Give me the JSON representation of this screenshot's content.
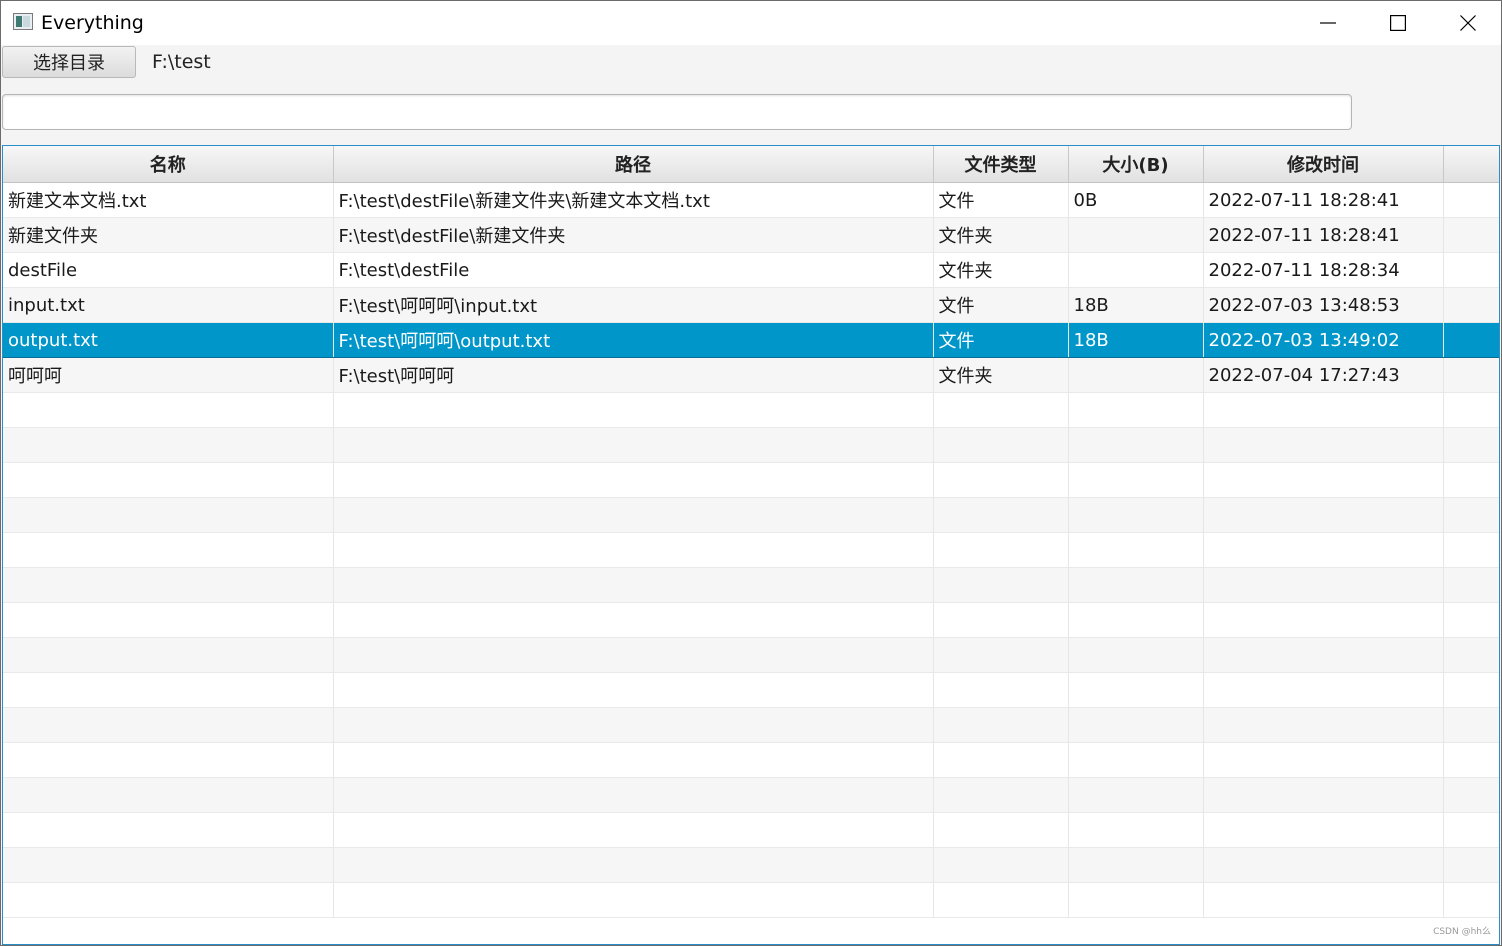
{
  "window": {
    "title": "Everything",
    "icon": "app-window-icon",
    "controls": [
      "minimize-icon",
      "maximize-icon",
      "close-icon"
    ]
  },
  "toolbar": {
    "choose_dir_label": "选择目录",
    "current_dir": "F:\\test"
  },
  "search": {
    "value": "",
    "placeholder": ""
  },
  "table": {
    "columns": [
      "名称",
      "路径",
      "文件类型",
      "大小(B)",
      "修改时间"
    ],
    "rows": [
      {
        "name": "新建文本文档.txt",
        "path": "F:\\test\\destFile\\新建文件夹\\新建文本文档.txt",
        "type": "文件",
        "size": "0B",
        "modified": "2022-07-11 18:28:41"
      },
      {
        "name": "新建文件夹",
        "path": "F:\\test\\destFile\\新建文件夹",
        "type": "文件夹",
        "size": "",
        "modified": "2022-07-11 18:28:41"
      },
      {
        "name": "destFile",
        "path": "F:\\test\\destFile",
        "type": "文件夹",
        "size": "",
        "modified": "2022-07-11 18:28:34"
      },
      {
        "name": "input.txt",
        "path": "F:\\test\\呵呵呵\\input.txt",
        "type": "文件",
        "size": "18B",
        "modified": "2022-07-03 13:48:53"
      },
      {
        "name": "output.txt",
        "path": "F:\\test\\呵呵呵\\output.txt",
        "type": "文件",
        "size": "18B",
        "modified": "2022-07-03 13:49:02"
      },
      {
        "name": "呵呵呵",
        "path": "F:\\test\\呵呵呵",
        "type": "文件夹",
        "size": "",
        "modified": "2022-07-04 17:27:43"
      }
    ],
    "selected_index": 4
  },
  "colors": {
    "selection": "#0096c9",
    "table_border": "#2a8fc9"
  },
  "watermark": "CSDN @hh么"
}
